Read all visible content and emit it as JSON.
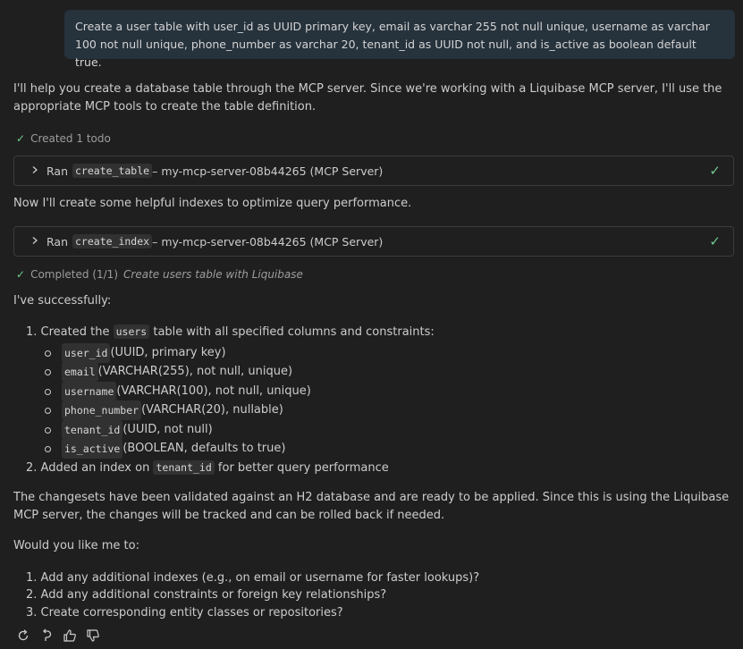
{
  "user_message": "Create a user table with user_id as UUID primary key, email as varchar 255 not null unique, username as varchar 100 not null unique, phone_number as varchar 20, tenant_id as UUID not null, and is_active as boolean default true.",
  "intro": "I'll help you create a database table through the MCP server. Since we're working with a Liquibase MCP server, I'll use the appropriate MCP tools to create the table definition.",
  "status_created": "Created 1 todo",
  "tool1": {
    "ran": "Ran",
    "name": "create_table",
    "detail": " – my-mcp-server-08b44265 (MCP Server)"
  },
  "mid_text": "Now I'll create some helpful indexes to optimize query performance.",
  "tool2": {
    "ran": "Ran",
    "name": "create_index",
    "detail": " – my-mcp-server-08b44265 (MCP Server)"
  },
  "status_completed": {
    "label": "Completed (1/1)",
    "task": "Create users table with Liquibase"
  },
  "success_text": "I've successfully:",
  "summary": {
    "item1": {
      "num": "1.",
      "before": "Created the ",
      "code": "users",
      "after": " table with all specified columns and constraints:"
    },
    "columns": [
      {
        "code": "user_id",
        "desc": " (UUID, primary key)"
      },
      {
        "code": "email",
        "desc": " (VARCHAR(255), not null, unique)"
      },
      {
        "code": "username",
        "desc": " (VARCHAR(100), not null, unique)"
      },
      {
        "code": "phone_number",
        "desc": " (VARCHAR(20), nullable)"
      },
      {
        "code": "tenant_id",
        "desc": " (UUID, not null)"
      },
      {
        "code": "is_active",
        "desc": " (BOOLEAN, defaults to true)"
      }
    ],
    "item2": {
      "num": "2.",
      "before": "Added an index on ",
      "code": "tenant_id",
      "after": " for better query performance"
    }
  },
  "changesets_text": "The changesets have been validated against an H2 database and are ready to be applied. Since this is using the Liquibase MCP server, the changes will be tracked and can be rolled back if needed.",
  "question": "Would you like me to:",
  "options": [
    {
      "num": "1.",
      "text": "Add any additional indexes (e.g., on email or username for faster lookups)?"
    },
    {
      "num": "2.",
      "text": "Add any additional constraints or foreign key relationships?"
    },
    {
      "num": "3.",
      "text": "Create corresponding entity classes or repositories?"
    }
  ],
  "icons": {
    "retry": "retry-icon",
    "undo": "undo-icon",
    "thumbs_up": "thumbs-up-icon",
    "thumbs_down": "thumbs-down-icon",
    "check": "check-icon",
    "chevron": "chevron-right-icon"
  },
  "colors": {
    "background": "#1f1f1f",
    "user_bubble": "#26323c",
    "success": "#73c991",
    "text": "#cccccc",
    "muted": "#9d9d9d"
  }
}
